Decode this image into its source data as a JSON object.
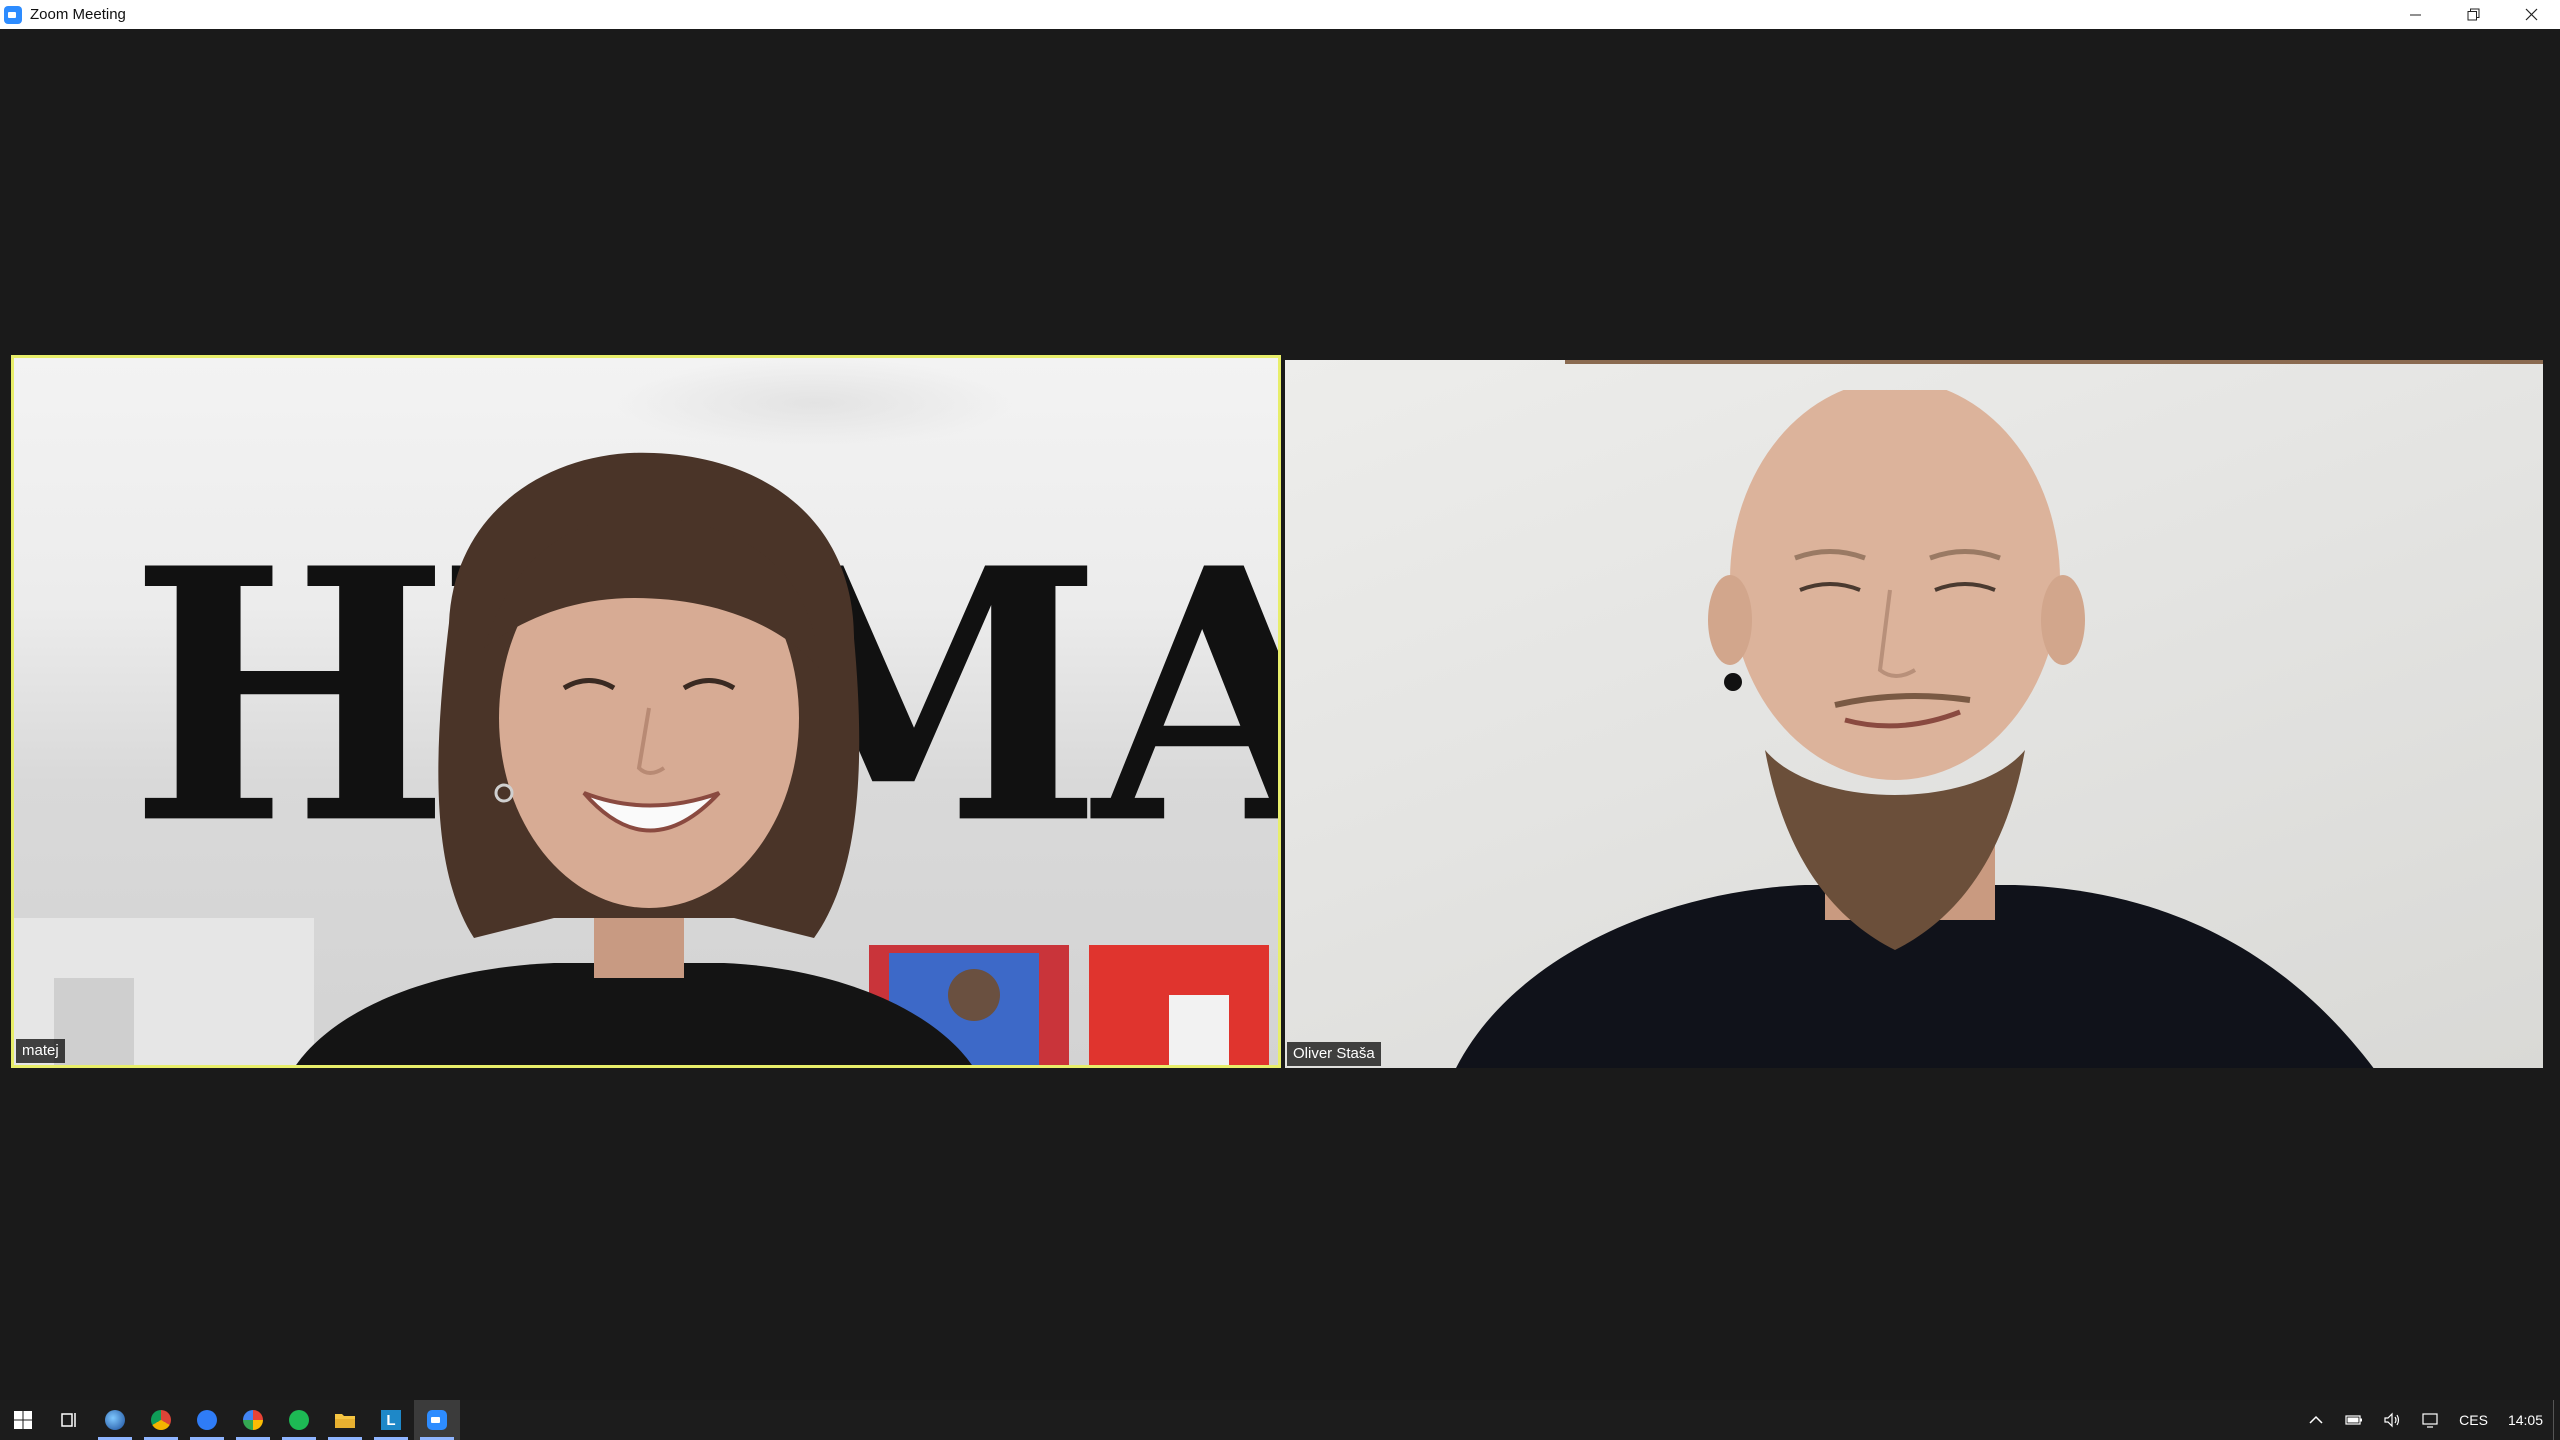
{
  "window": {
    "title": "Zoom Meeting",
    "minimize_label": "–",
    "restore_label": "❐",
    "close_label": "✕"
  },
  "tiles": [
    {
      "name": "matej",
      "overlay_text": "HUMAN",
      "active_speaker": true
    },
    {
      "name": "Oliver Staša",
      "active_speaker": false
    }
  ],
  "taskbar": {
    "apps": [
      {
        "icon": "windows-start-icon"
      },
      {
        "icon": "task-view-icon"
      },
      {
        "icon": "browser-icon"
      },
      {
        "icon": "chrome-icon"
      },
      {
        "icon": "messenger-icon"
      },
      {
        "icon": "app-circle-icon"
      },
      {
        "icon": "spotify-icon"
      },
      {
        "icon": "file-explorer-icon"
      },
      {
        "icon": "l-app-icon"
      },
      {
        "icon": "zoom-icon",
        "active": true
      }
    ],
    "tray": {
      "language": "CES",
      "time": "14:05"
    }
  },
  "colors": {
    "active_speaker_border": "#e8ee6a",
    "background": "#1a1a1a",
    "zoom_blue": "#2d8cff"
  }
}
